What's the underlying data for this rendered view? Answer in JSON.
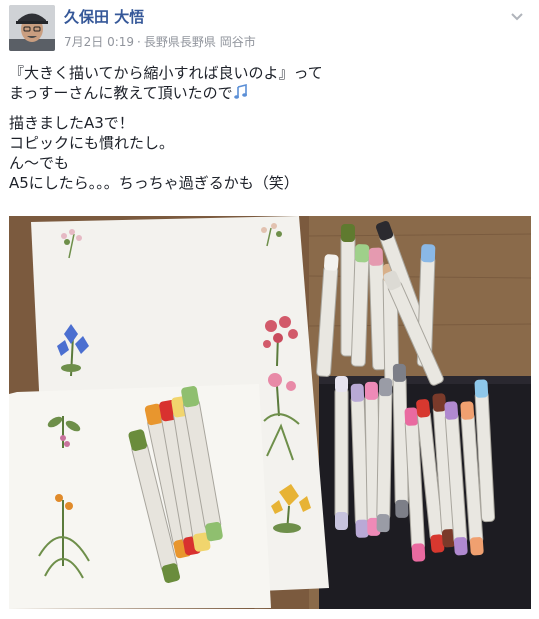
{
  "post": {
    "author": "久保田 大悟",
    "date": "7月2日 0:19",
    "location": "長野県長野県 岡谷市",
    "separator": "·",
    "chevron_icon": "chevron-down-icon",
    "message_lines": [
      "『大きく描いてから縮小すれば良いのよ』って",
      "まっすーさんに教えて頂いたので",
      "描きましたA3で！",
      "コピックにも慣れたし。",
      "ん〜でも",
      "A5にしたら。。。ちっちゃ過ぎるかも（笑）"
    ],
    "emoji_icon": "musical-notes-icon"
  },
  "colors": {
    "author_link": "#365899",
    "meta_gray": "#90949c",
    "text": "#1d2129"
  }
}
